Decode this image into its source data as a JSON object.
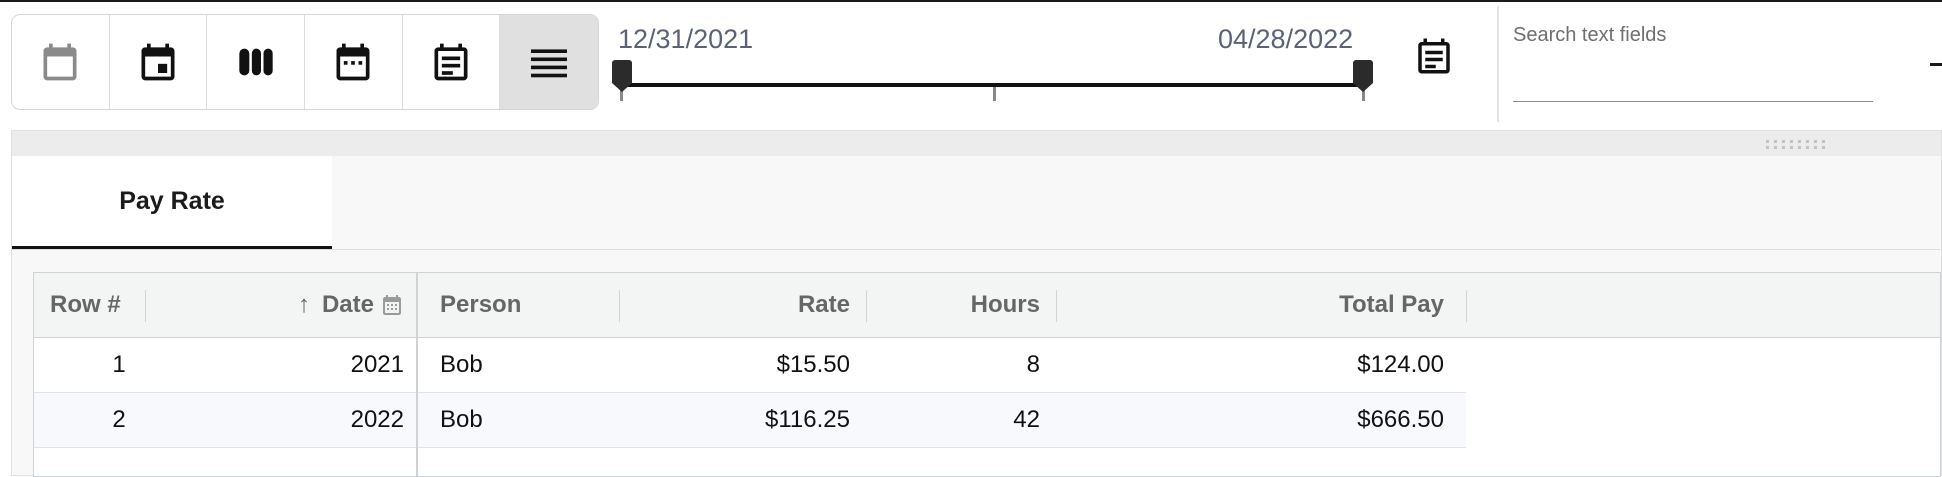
{
  "toolbar": {
    "views": [
      {
        "icon": "calendar-blank-icon",
        "active": false
      },
      {
        "icon": "calendar-today-icon",
        "active": false
      },
      {
        "icon": "view-columns-icon",
        "active": false
      },
      {
        "icon": "calendar-dots-icon",
        "active": false
      },
      {
        "icon": "calendar-agenda-icon",
        "active": false
      },
      {
        "icon": "list-lines-icon",
        "active": true
      }
    ]
  },
  "range": {
    "start": "12/31/2021",
    "end": "04/28/2022"
  },
  "search": {
    "label": "Search text fields",
    "value": ""
  },
  "tabs": [
    {
      "label": "Pay Rate",
      "active": true
    }
  ],
  "table": {
    "columns": [
      "Row #",
      "Date",
      "Person",
      "Rate",
      "Hours",
      "Total Pay"
    ],
    "rows": [
      [
        "1",
        "2021",
        "Bob",
        "$15.50",
        "8",
        "$124.00"
      ],
      [
        "2",
        "2022",
        "Bob",
        "$116.25",
        "42",
        "$666.50"
      ]
    ]
  },
  "colors": {
    "accent_text": "#5b6275",
    "active_view_bg": "#e0e0e0",
    "tab_underline": "#111111"
  }
}
